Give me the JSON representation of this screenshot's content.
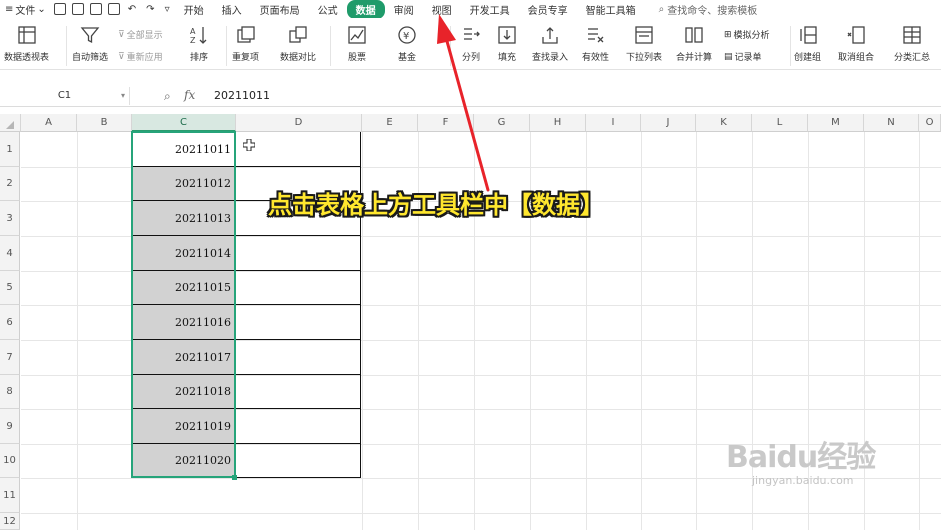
{
  "menu": {
    "hamburger": "≡",
    "file": "文件",
    "tabs": [
      "开始",
      "插入",
      "页面布局",
      "公式",
      "数据",
      "审阅",
      "视图",
      "开发工具",
      "会员专享",
      "智能工具箱"
    ],
    "active_tab": "数据",
    "search_placeholder": "查找命令、搜索模板"
  },
  "ribbon": {
    "pivot_table": "数据透视表",
    "auto_filter": "自动筛选",
    "show_all": "全部显示",
    "reapply": "重新应用",
    "sort": "排序",
    "duplicates": "重复项",
    "compare": "数据对比",
    "stock": "股票",
    "fund": "基金",
    "split": "分列",
    "fill": "填充",
    "lookup_entry": "查找录入",
    "validation": "有效性",
    "dropdown_list": "下拉列表",
    "consolidate": "合并计算",
    "simulation": "模拟分析",
    "record_form": "记录单",
    "group": "创建组",
    "ungroup": "取消组合",
    "subtotal": "分类汇总"
  },
  "formula_bar": {
    "cell_ref": "C1",
    "fx": "fx",
    "value": "20211011"
  },
  "sheet": {
    "columns": [
      "A",
      "B",
      "C",
      "D",
      "E",
      "F",
      "G",
      "H",
      "I",
      "J",
      "K",
      "L",
      "M",
      "N",
      "O"
    ],
    "selected_column": "C",
    "rows": [
      "1",
      "2",
      "3",
      "4",
      "5",
      "6",
      "7",
      "8",
      "9",
      "10",
      "11",
      "12"
    ],
    "c_values": [
      "20211011",
      "20211012",
      "20211013",
      "20211014",
      "20211015",
      "20211016",
      "20211017",
      "20211018",
      "20211019",
      "20211020"
    ]
  },
  "annotation": "点击表格上方工具栏中【数据】",
  "watermark": {
    "logo": "Baidu经验",
    "url": "jingyan.baidu.com"
  },
  "colors": {
    "accent": "#1f9b6a",
    "selection": "#26a47a",
    "arrow": "#e8232a",
    "annotation_text": "#ffe72e"
  }
}
